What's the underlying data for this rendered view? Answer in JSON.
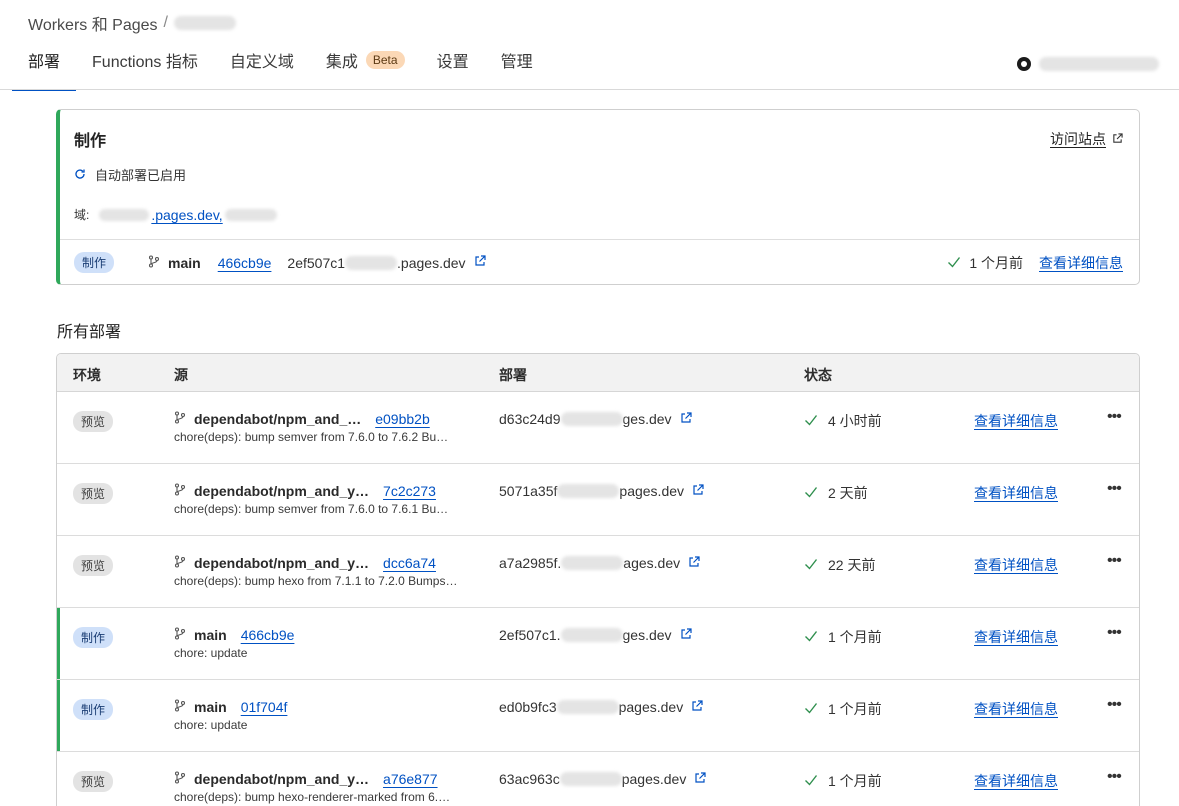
{
  "breadcrumb": {
    "root": "Workers 和 Pages",
    "separator": "/"
  },
  "tabs": [
    {
      "label": "部署",
      "active": true
    },
    {
      "label": "Functions 指标"
    },
    {
      "label": "自定义域"
    },
    {
      "label": "集成",
      "badge": "Beta"
    },
    {
      "label": "设置"
    },
    {
      "label": "管理"
    }
  ],
  "production": {
    "title": "制作",
    "visit_label": "访问站点",
    "auto_deploy": "自动部署已启用",
    "domains_label": "域:",
    "domain_suffix": ".pages.dev,",
    "env": "制作",
    "branch": "main",
    "commit": "466cb9e",
    "url_prefix": "2ef507c1",
    "url_suffix": ".pages.dev",
    "time": "1 个月前",
    "details_label": "查看详细信息"
  },
  "all_deployments": {
    "title": "所有部署",
    "columns": [
      "环境",
      "源",
      "部署",
      "状态"
    ],
    "rows": [
      {
        "env": "预览",
        "env_type": "preview",
        "branch": "dependabot/npm_and_…",
        "commit": "e09bb2b",
        "message": "chore(deps): bump semver from 7.6.0 to 7.6.2 Bu…",
        "url_prefix": "d63c24d9",
        "url_suffix": "ges.dev",
        "status": "4 小时前",
        "details": "查看详细信息"
      },
      {
        "env": "预览",
        "env_type": "preview",
        "branch": "dependabot/npm_and_y…",
        "commit": "7c2c273",
        "message": "chore(deps): bump semver from 7.6.0 to 7.6.1 Bu…",
        "url_prefix": "5071a35f",
        "url_suffix": "pages.dev",
        "status": "2 天前",
        "details": "查看详细信息"
      },
      {
        "env": "预览",
        "env_type": "preview",
        "branch": "dependabot/npm_and_y…",
        "commit": "dcc6a74",
        "message": "chore(deps): bump hexo from 7.1.1 to 7.2.0 Bumps…",
        "url_prefix": "a7a2985f.",
        "url_suffix": "ages.dev",
        "status": "22 天前",
        "details": "查看详细信息"
      },
      {
        "env": "制作",
        "env_type": "prod",
        "branch": "main",
        "commit": "466cb9e",
        "message": "chore: update",
        "url_prefix": "2ef507c1.",
        "url_suffix": "ges.dev",
        "status": "1 个月前",
        "details": "查看详细信息"
      },
      {
        "env": "制作",
        "env_type": "prod",
        "branch": "main",
        "commit": "01f704f",
        "message": "chore: update",
        "url_prefix": "ed0b9fc3",
        "url_suffix": "pages.dev",
        "status": "1 个月前",
        "details": "查看详细信息"
      },
      {
        "env": "预览",
        "env_type": "preview",
        "branch": "dependabot/npm_and_y…",
        "commit": "a76e877",
        "message": "chore(deps): bump hexo-renderer-marked from 6.…",
        "url_prefix": "63ac963c",
        "url_suffix": "pages.dev",
        "status": "1 个月前",
        "details": "查看详细信息"
      }
    ]
  },
  "icons": {
    "branch": "git-branch-icon",
    "external": "external-link-icon",
    "check": "check-icon",
    "more": "more-icon",
    "refresh": "refresh-icon",
    "github": "github-icon"
  },
  "colors": {
    "link": "#0051c3",
    "production_accent": "#2fa85b",
    "beta_badge": "#fbd8b6"
  }
}
